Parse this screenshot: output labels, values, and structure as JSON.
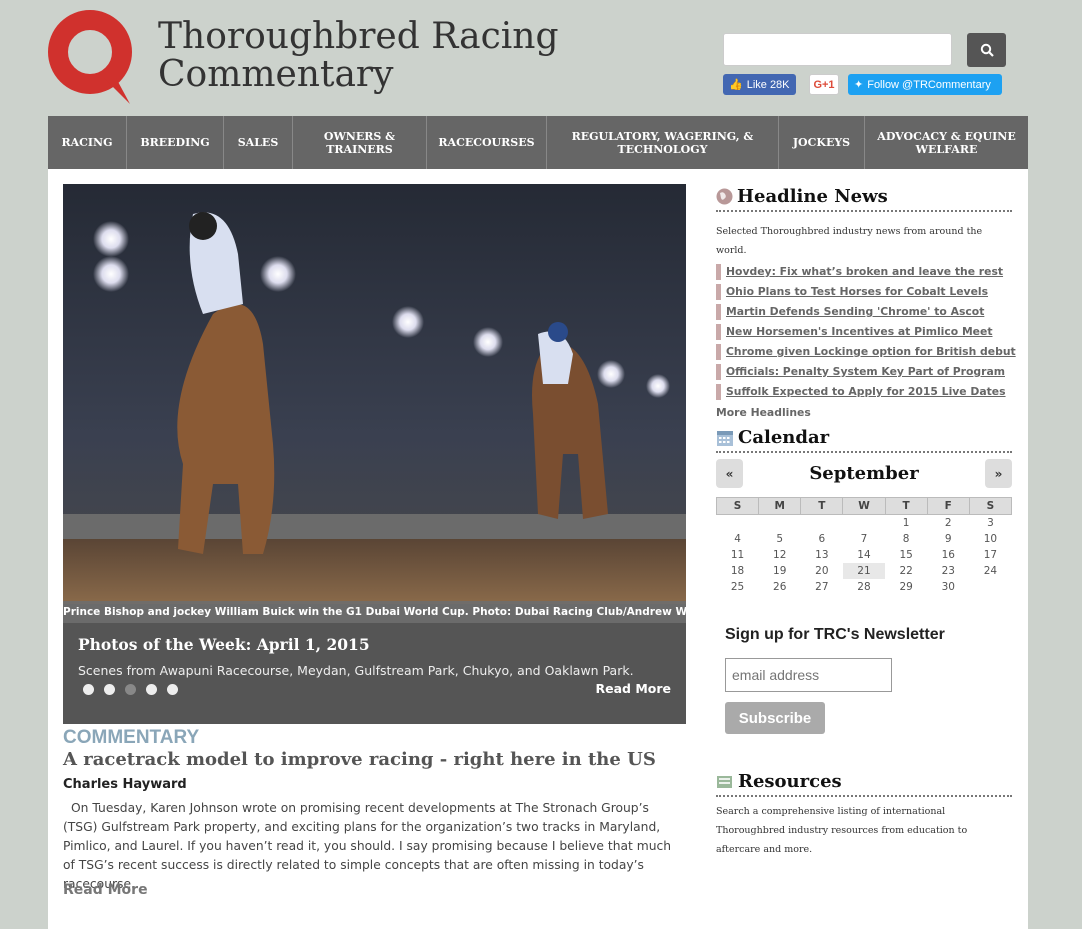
{
  "header": {
    "title_line1": "Thoroughbred Racing",
    "title_line2": "Commentary",
    "search": {
      "placeholder": ""
    },
    "social": {
      "facebook": "Like 28K",
      "gplus": "G+1",
      "twitter": "Follow @TRCommentary"
    }
  },
  "nav": {
    "items": [
      "RACING",
      "BREEDING",
      "SALES",
      "OWNERS & TRAINERS",
      "RACECOURSES",
      "REGULATORY, WAGERING, & TECHNOLOGY",
      "JOCKEYS",
      "ADVOCACY & EQUINE WELFARE"
    ]
  },
  "hero": {
    "caption": "Prince Bishop and jockey William Buick win the G1 Dubai World Cup. Photo: Dubai Racing Club/Andrew Watkins",
    "title": "Photos of the Week: April 1, 2015",
    "description": "Scenes from Awapuni Racecourse, Meydan, Gulfstream Park, Chukyo, and Oaklawn Park.",
    "read_more": "Read More"
  },
  "commentary": {
    "label": "COMMENTARY",
    "title": "A racetrack model to improve racing - right here in the US",
    "author": "Charles Hayward",
    "excerpt": "On Tuesday, Karen Johnson wrote on promising recent developments at The Stronach Group’s (TSG) Gulfstream Park property, and exciting plans for the organization’s two tracks in Maryland, Pimlico, and Laurel. If you haven’t read it, you should. I say promising because I believe that much of TSG’s recent success is directly related to simple concepts that are often missing in today’s racecourse...",
    "read_more": "Read More"
  },
  "headlines": {
    "title": "Headline News",
    "intro": "Selected Thoroughbred industry news from around the world.",
    "items": [
      "Hovdey: Fix what’s broken and leave the rest",
      "Ohio Plans to Test Horses for Cobalt Levels",
      "Martin Defends Sending 'Chrome' to Ascot",
      "New Horsemen's Incentives at Pimlico Meet",
      "Chrome given Lockinge option for British debut",
      "Officials: Penalty System Key Part of Program",
      "Suffolk Expected to Apply for 2015 Live Dates"
    ],
    "more": "More Headlines"
  },
  "calendar": {
    "title": "Calendar",
    "prev": "«",
    "next": "»",
    "month": "September",
    "days": [
      "S",
      "M",
      "T",
      "W",
      "T",
      "F",
      "S"
    ],
    "weeks": [
      [
        "",
        "",
        "",
        "",
        "1",
        "2",
        "3"
      ],
      [
        "4",
        "5",
        "6",
        "7",
        "8",
        "9",
        "10"
      ],
      [
        "11",
        "12",
        "13",
        "14",
        "15",
        "16",
        "17"
      ],
      [
        "18",
        "19",
        "20",
        "21",
        "22",
        "23",
        "24"
      ],
      [
        "25",
        "26",
        "27",
        "28",
        "29",
        "30",
        ""
      ]
    ],
    "today": "21"
  },
  "newsletter": {
    "title": "Sign up for TRC's Newsletter",
    "placeholder": "email address",
    "button": "Subscribe"
  },
  "resources": {
    "title": "Resources",
    "description": "Search a comprehensive listing of international Thoroughbred industry resources from education to aftercare and more."
  },
  "colors": {
    "logo_red": "#d0312d",
    "nav_bg": "#666666",
    "headline_border": "#c9a9a9",
    "commentary_label": "#8aa6b8"
  }
}
